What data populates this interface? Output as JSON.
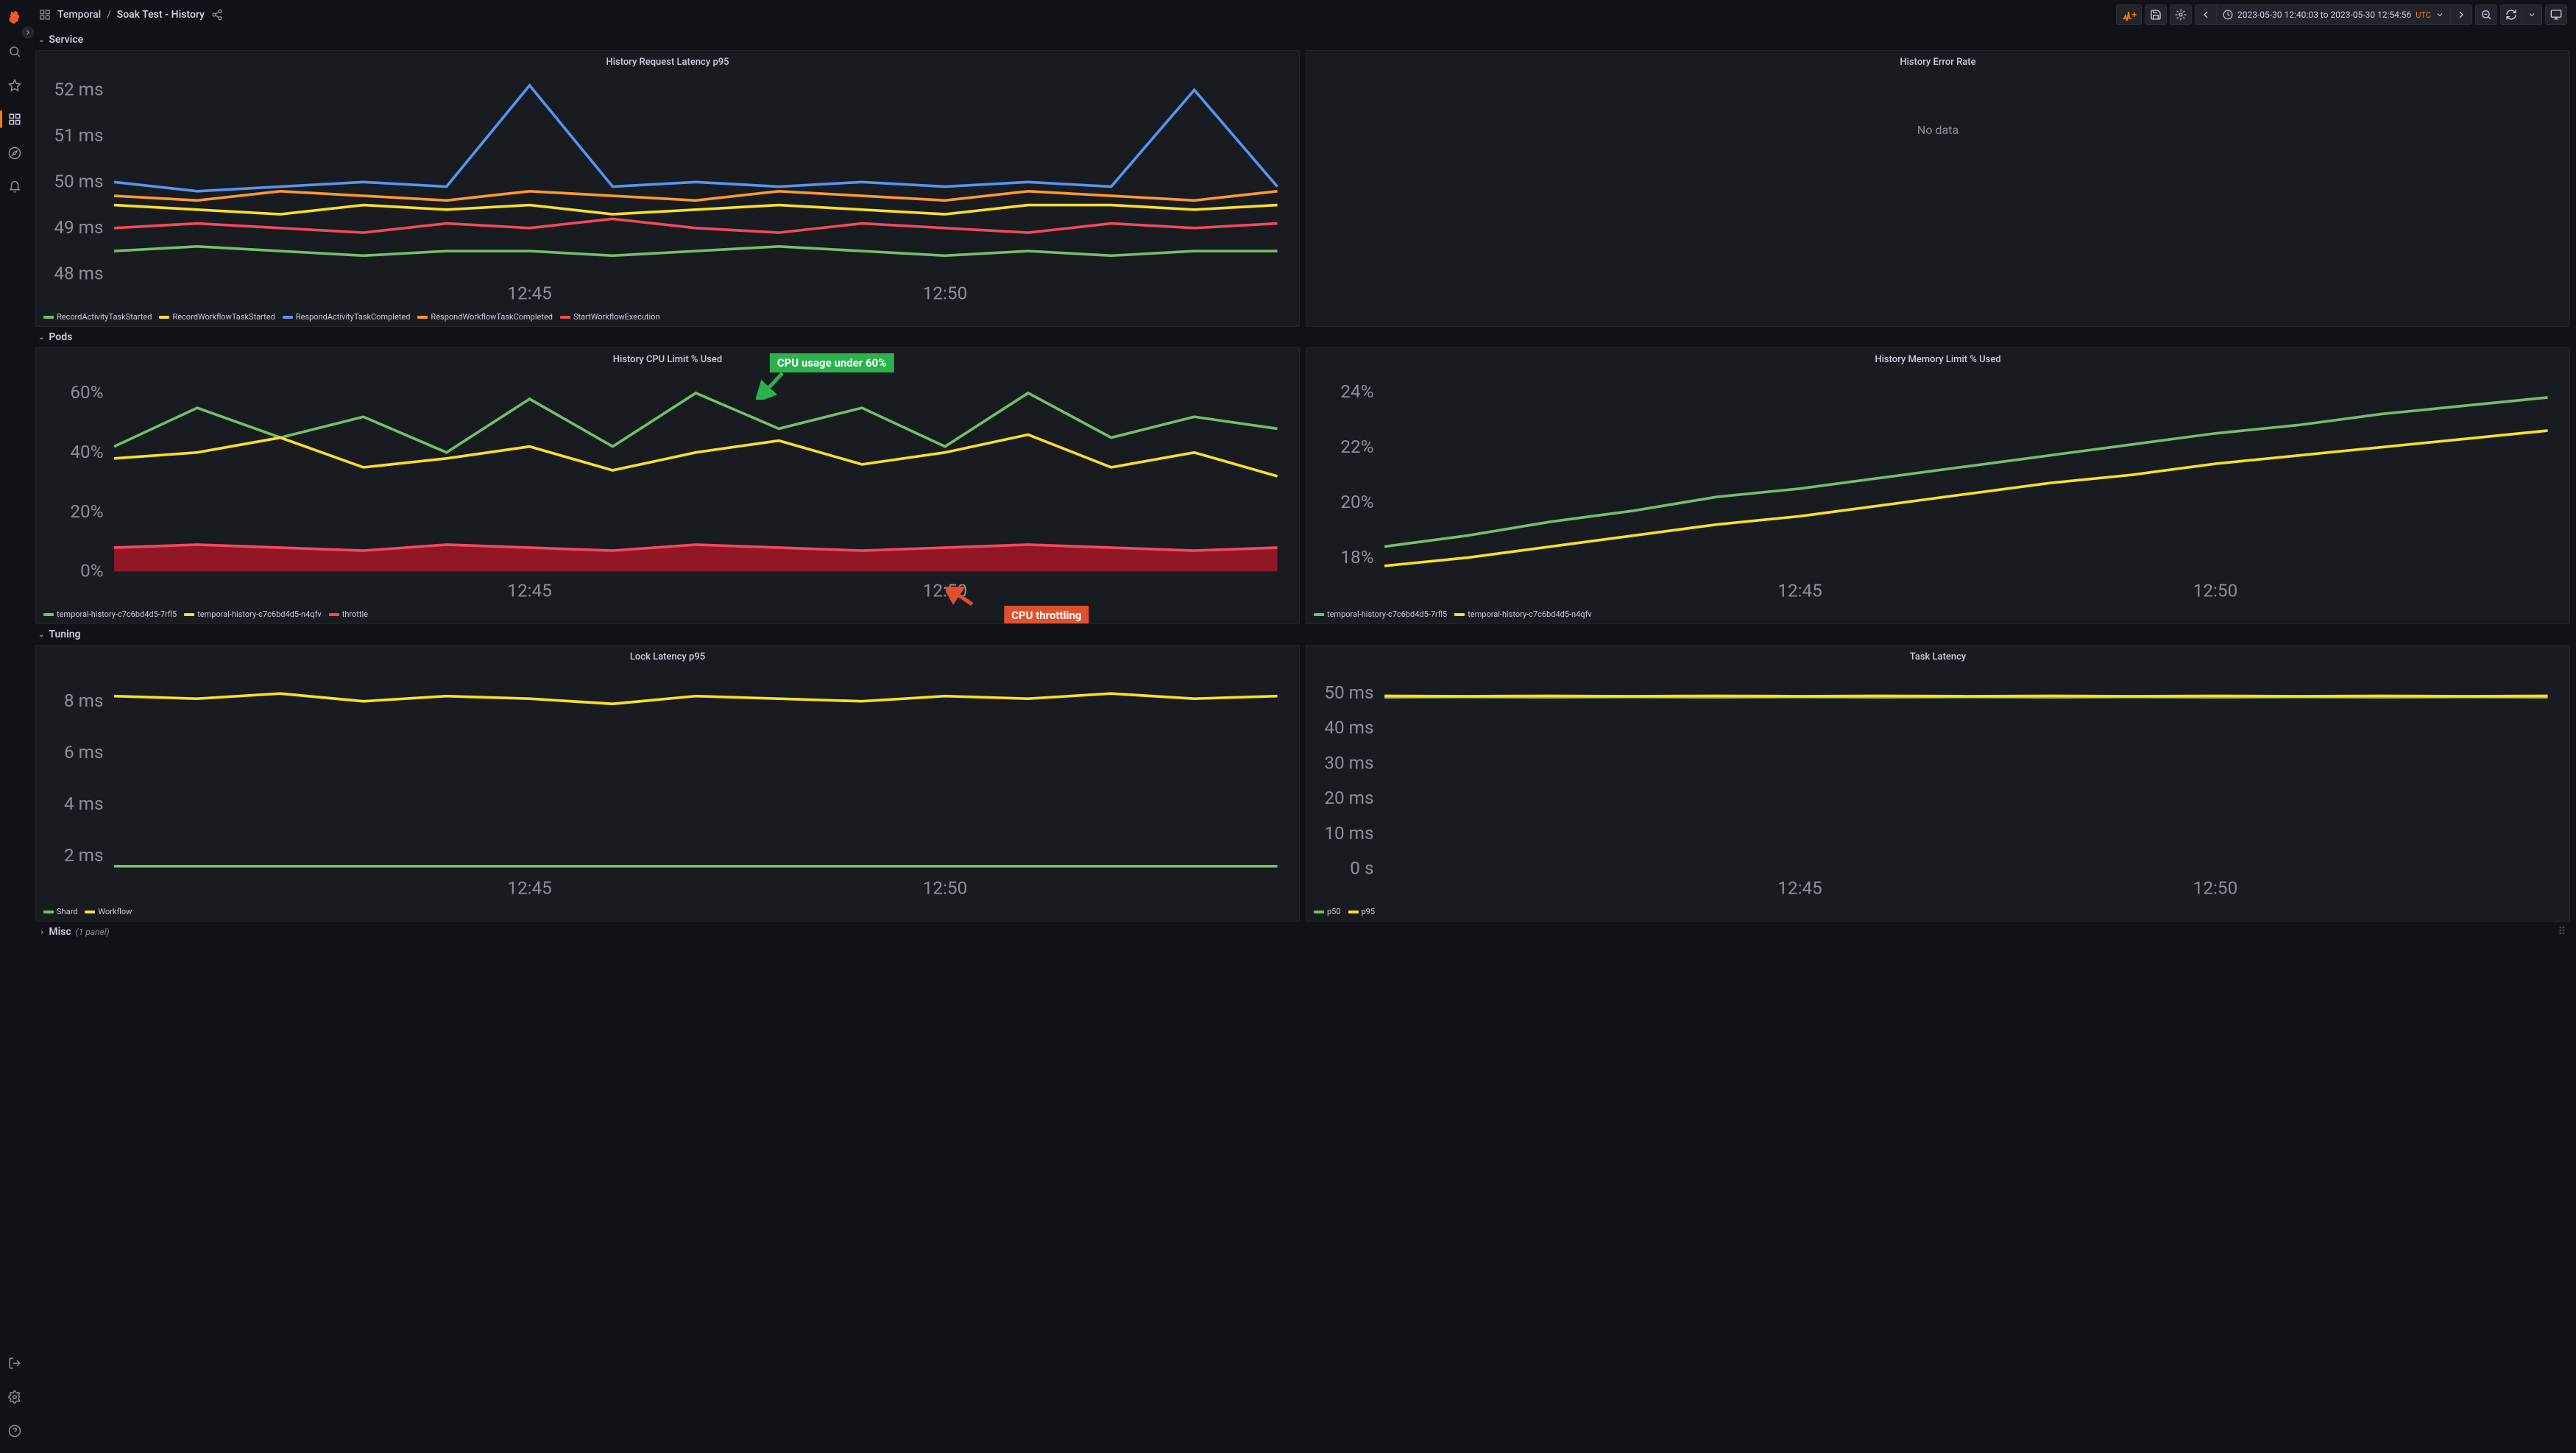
{
  "breadcrumb": {
    "root_icon": "panel",
    "root": "Temporal",
    "leaf": "Soak Test - History"
  },
  "timepicker": {
    "label": "2023-05-30 12:40:03 to 2023-05-30 12:54:56",
    "tz": "UTC"
  },
  "rows": {
    "service": {
      "label": "Service"
    },
    "pods": {
      "label": "Pods"
    },
    "tuning": {
      "label": "Tuning"
    },
    "misc": {
      "label": "Misc",
      "count": "(1 panel)"
    }
  },
  "colors": {
    "green": "#73bf69",
    "yellow": "#fade2a",
    "blue": "#5794f2",
    "orange": "#ff9830",
    "red": "#f2495c",
    "red_fill": "rgba(196,22,42,0.7)"
  },
  "annotations": {
    "cpu_usage": {
      "text": "CPU usage under 60%",
      "bg": "#2bb24c"
    },
    "cpu_throttle": {
      "text": "CPU throttling",
      "bg": "#e0502f"
    }
  },
  "chart_data": [
    {
      "id": "history-request-latency",
      "type": "line",
      "title": "History Request Latency p95",
      "ylabel": "",
      "ylim": [
        48,
        52.2
      ],
      "yunit": "ms",
      "yticks": [
        48,
        49,
        50,
        51,
        52
      ],
      "x": [
        "12:40",
        "12:41",
        "12:42",
        "12:43",
        "12:44",
        "12:45",
        "12:46",
        "12:47",
        "12:48",
        "12:49",
        "12:50",
        "12:51",
        "12:52",
        "12:53",
        "12:54"
      ],
      "xticks": [
        "12:45",
        "12:50"
      ],
      "series": [
        {
          "name": "RecordActivityTaskStarted",
          "color": "green",
          "values": [
            48.5,
            48.6,
            48.5,
            48.4,
            48.5,
            48.5,
            48.4,
            48.5,
            48.6,
            48.5,
            48.4,
            48.5,
            48.4,
            48.5,
            48.5
          ]
        },
        {
          "name": "RecordWorkflowTaskStarted",
          "color": "yellow",
          "values": [
            49.5,
            49.4,
            49.3,
            49.5,
            49.4,
            49.5,
            49.3,
            49.4,
            49.5,
            49.4,
            49.3,
            49.5,
            49.5,
            49.4,
            49.5
          ]
        },
        {
          "name": "RespondActivityTaskCompleted",
          "color": "blue",
          "values": [
            50.0,
            49.8,
            49.9,
            50.0,
            49.9,
            52.1,
            49.9,
            50.0,
            49.9,
            50.0,
            49.9,
            50.0,
            49.9,
            52.0,
            49.9
          ]
        },
        {
          "name": "RespondWorkflowTaskCompleted",
          "color": "orange",
          "values": [
            49.7,
            49.6,
            49.8,
            49.7,
            49.6,
            49.8,
            49.7,
            49.6,
            49.8,
            49.7,
            49.6,
            49.8,
            49.7,
            49.6,
            49.8
          ]
        },
        {
          "name": "StartWorkflowExecution",
          "color": "red",
          "values": [
            49.0,
            49.1,
            49.0,
            48.9,
            49.1,
            49.0,
            49.2,
            49.0,
            48.9,
            49.1,
            49.0,
            48.9,
            49.1,
            49.0,
            49.1
          ]
        }
      ]
    },
    {
      "id": "history-error-rate",
      "type": "line",
      "title": "History Error Rate",
      "no_data": "No data"
    },
    {
      "id": "history-cpu-limit",
      "type": "line",
      "title": "History CPU Limit % Used",
      "ylim": [
        0,
        65
      ],
      "yunit": "%",
      "yticks": [
        0,
        20,
        40,
        60
      ],
      "x": [
        "12:40",
        "12:41",
        "12:42",
        "12:43",
        "12:44",
        "12:45",
        "12:46",
        "12:47",
        "12:48",
        "12:49",
        "12:50",
        "12:51",
        "12:52",
        "12:53",
        "12:54"
      ],
      "xticks": [
        "12:45",
        "12:50"
      ],
      "series": [
        {
          "name": "temporal-history-c7c6bd4d5-7rfl5",
          "color": "green",
          "values": [
            42,
            55,
            45,
            52,
            40,
            58,
            42,
            60,
            48,
            55,
            42,
            60,
            45,
            52,
            48
          ]
        },
        {
          "name": "temporal-history-c7c6bd4d5-n4qfv",
          "color": "yellow",
          "values": [
            38,
            40,
            45,
            35,
            38,
            42,
            34,
            40,
            44,
            36,
            40,
            46,
            35,
            40,
            32
          ]
        },
        {
          "name": "throttle",
          "color": "red",
          "fill": true,
          "values": [
            8,
            9,
            8,
            7,
            9,
            8,
            7,
            9,
            8,
            7,
            8,
            9,
            8,
            7,
            8
          ]
        }
      ]
    },
    {
      "id": "history-memory-limit",
      "type": "line",
      "title": "History Memory Limit % Used",
      "ylim": [
        17.5,
        24.5
      ],
      "yunit": "%",
      "yticks": [
        18,
        20,
        22,
        24
      ],
      "x": [
        "12:40",
        "12:41",
        "12:42",
        "12:43",
        "12:44",
        "12:45",
        "12:46",
        "12:47",
        "12:48",
        "12:49",
        "12:50",
        "12:51",
        "12:52",
        "12:53",
        "12:54"
      ],
      "xticks": [
        "12:45",
        "12:50"
      ],
      "series": [
        {
          "name": "temporal-history-c7c6bd4d5-7rfl5",
          "color": "green",
          "values": [
            18.4,
            18.8,
            19.3,
            19.7,
            20.2,
            20.5,
            20.9,
            21.3,
            21.7,
            22.1,
            22.5,
            22.8,
            23.2,
            23.5,
            23.8
          ]
        },
        {
          "name": "temporal-history-c7c6bd4d5-n4qfv",
          "color": "yellow",
          "values": [
            17.7,
            18.0,
            18.4,
            18.8,
            19.2,
            19.5,
            19.9,
            20.3,
            20.7,
            21.0,
            21.4,
            21.7,
            22.0,
            22.3,
            22.6
          ]
        }
      ]
    },
    {
      "id": "lock-latency",
      "type": "line",
      "title": "Lock Latency p95",
      "ylim": [
        1.5,
        9
      ],
      "yunit": "ms",
      "yticks": [
        2,
        4,
        6,
        8
      ],
      "x": [
        "12:40",
        "12:41",
        "12:42",
        "12:43",
        "12:44",
        "12:45",
        "12:46",
        "12:47",
        "12:48",
        "12:49",
        "12:50",
        "12:51",
        "12:52",
        "12:53",
        "12:54"
      ],
      "xticks": [
        "12:45",
        "12:50"
      ],
      "series": [
        {
          "name": "Shard",
          "color": "green",
          "values": [
            1.6,
            1.6,
            1.6,
            1.6,
            1.6,
            1.6,
            1.6,
            1.6,
            1.6,
            1.6,
            1.6,
            1.6,
            1.6,
            1.6,
            1.6
          ]
        },
        {
          "name": "Workflow",
          "color": "yellow",
          "values": [
            8.2,
            8.1,
            8.3,
            8.0,
            8.2,
            8.1,
            7.9,
            8.2,
            8.1,
            8.0,
            8.2,
            8.1,
            8.3,
            8.1,
            8.2
          ]
        }
      ]
    },
    {
      "id": "task-latency",
      "type": "line",
      "title": "Task Latency",
      "ylim": [
        0,
        55
      ],
      "yunit": "ms",
      "yticks": [
        0,
        10,
        20,
        30,
        40,
        50
      ],
      "yzero_label": "0 s",
      "x": [
        "12:40",
        "12:41",
        "12:42",
        "12:43",
        "12:44",
        "12:45",
        "12:46",
        "12:47",
        "12:48",
        "12:49",
        "12:50",
        "12:51",
        "12:52",
        "12:53",
        "12:54"
      ],
      "xticks": [
        "12:45",
        "12:50"
      ],
      "series": [
        {
          "name": "p50",
          "color": "green",
          "values": [
            48.8,
            48.9,
            48.8,
            48.9,
            48.8,
            48.9,
            48.8,
            48.9,
            48.8,
            48.9,
            48.8,
            48.9,
            48.8,
            48.9,
            48.8
          ]
        },
        {
          "name": "p95",
          "color": "yellow",
          "values": [
            49.2,
            49.1,
            49.2,
            49.1,
            49.2,
            49.1,
            49.2,
            49.1,
            49.2,
            49.1,
            49.2,
            49.1,
            49.2,
            49.1,
            49.2
          ]
        }
      ]
    }
  ]
}
